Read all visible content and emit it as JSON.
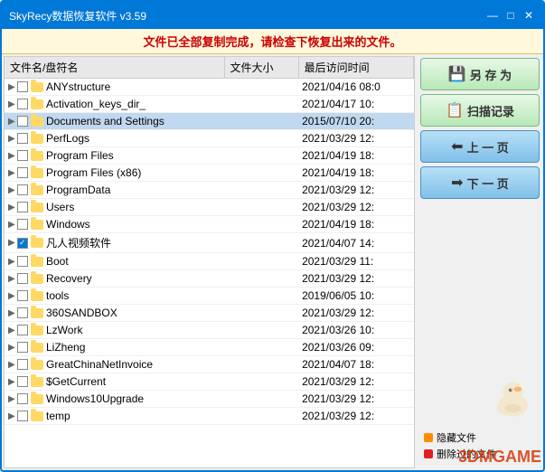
{
  "window": {
    "title": "SkyRecy数据恢复软件 v3.59",
    "controls": {
      "minimize": "—",
      "maximize": "□",
      "close": "✕"
    }
  },
  "status_message": "文件已全部复制完成，请检查下恢复出来的文件。",
  "table": {
    "headers": [
      "文件名/盘符名",
      "文件大小",
      "最后访问时间"
    ],
    "rows": [
      {
        "indent": 1,
        "checked": false,
        "expanded": false,
        "type": "folder",
        "name": "ANYstructure",
        "size": "",
        "date": "2021/04/16 08:0",
        "selected": false
      },
      {
        "indent": 1,
        "checked": false,
        "expanded": false,
        "type": "folder",
        "name": "Activation_keys_dir_",
        "size": "",
        "date": "2021/04/17 10:",
        "selected": false
      },
      {
        "indent": 1,
        "checked": false,
        "expanded": false,
        "type": "folder",
        "name": "Documents and Settings",
        "size": "",
        "date": "2015/07/10 20:",
        "selected": true
      },
      {
        "indent": 1,
        "checked": false,
        "expanded": false,
        "type": "folder",
        "name": "PerfLogs",
        "size": "",
        "date": "2021/03/29 12:",
        "selected": false
      },
      {
        "indent": 1,
        "checked": false,
        "expanded": false,
        "type": "folder",
        "name": "Program Files",
        "size": "",
        "date": "2021/04/19 18:",
        "selected": false
      },
      {
        "indent": 1,
        "checked": false,
        "expanded": false,
        "type": "folder",
        "name": "Program Files (x86)",
        "size": "",
        "date": "2021/04/19 18:",
        "selected": false
      },
      {
        "indent": 1,
        "checked": false,
        "expanded": false,
        "type": "folder",
        "name": "ProgramData",
        "size": "",
        "date": "2021/03/29 12:",
        "selected": false
      },
      {
        "indent": 1,
        "checked": false,
        "expanded": false,
        "type": "folder",
        "name": "Users",
        "size": "",
        "date": "2021/03/29 12:",
        "selected": false
      },
      {
        "indent": 1,
        "checked": false,
        "expanded": false,
        "type": "folder",
        "name": "Windows",
        "size": "",
        "date": "2021/04/19 18:",
        "selected": false
      },
      {
        "indent": 1,
        "checked": true,
        "expanded": false,
        "type": "folder",
        "name": "凡人视频软件",
        "size": "",
        "date": "2021/04/07 14:",
        "selected": false
      },
      {
        "indent": 1,
        "checked": false,
        "expanded": false,
        "type": "folder",
        "name": "Boot",
        "size": "",
        "date": "2021/03/29 11:",
        "selected": false
      },
      {
        "indent": 1,
        "checked": false,
        "expanded": false,
        "type": "folder",
        "name": "Recovery",
        "size": "",
        "date": "2021/03/29 12:",
        "selected": false
      },
      {
        "indent": 1,
        "checked": false,
        "expanded": false,
        "type": "folder",
        "name": "tools",
        "size": "",
        "date": "2019/06/05 10:",
        "selected": false
      },
      {
        "indent": 1,
        "checked": false,
        "expanded": false,
        "type": "folder",
        "name": "360SANDBOX",
        "size": "",
        "date": "2021/03/29 12:",
        "selected": false
      },
      {
        "indent": 1,
        "checked": false,
        "expanded": false,
        "type": "folder",
        "name": "LzWork",
        "size": "",
        "date": "2021/03/26 10:",
        "selected": false
      },
      {
        "indent": 1,
        "checked": false,
        "expanded": false,
        "type": "folder",
        "name": "LiZheng",
        "size": "",
        "date": "2021/03/26 09:",
        "selected": false
      },
      {
        "indent": 1,
        "checked": false,
        "expanded": false,
        "type": "folder",
        "name": "GreatChinaNetInvoice",
        "size": "",
        "date": "2021/04/07 18:",
        "selected": false
      },
      {
        "indent": 1,
        "checked": false,
        "expanded": false,
        "type": "folder",
        "name": "$GetCurrent",
        "size": "",
        "date": "2021/03/29 12:",
        "selected": false
      },
      {
        "indent": 1,
        "checked": false,
        "expanded": false,
        "type": "folder",
        "name": "Windows10Upgrade",
        "size": "",
        "date": "2021/03/29 12:",
        "selected": false
      },
      {
        "indent": 1,
        "checked": false,
        "expanded": false,
        "type": "folder",
        "name": "temp",
        "size": "",
        "date": "2021/03/29 12:",
        "selected": false
      }
    ]
  },
  "buttons": {
    "save_as": "另 存 为",
    "scan_log": "扫描记录",
    "prev_page": "上 一 页",
    "next_page": "下 一 页"
  },
  "legend": {
    "hidden_file": {
      "color": "#ff8c00",
      "label": "隐藏文件"
    },
    "deleted_file": {
      "color": "#e02020",
      "label": "删除过的文件"
    }
  },
  "watermark": "3DMGAME"
}
